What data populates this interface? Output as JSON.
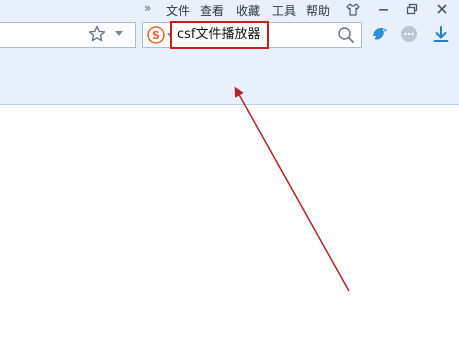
{
  "menubar": {
    "more_glyph": "»",
    "items": [
      "文件",
      "查看",
      "收藏",
      "工具",
      "帮助"
    ]
  },
  "window_controls": {
    "skin": "skin-icon",
    "minimize": "minimize-icon",
    "restore": "restore-icon",
    "close": "close-icon"
  },
  "addressbar": {
    "icons": [
      "star-icon",
      "chevron-down-icon"
    ]
  },
  "search": {
    "engine_icon": "sogou-icon",
    "value": "csf文件播放器",
    "highlight_color": "#c81e1e"
  },
  "toolbar": {
    "icons": [
      "bird-icon",
      "more-icon",
      "download-icon"
    ]
  },
  "annotation": {
    "arrow_color": "#b22222"
  },
  "colors": {
    "chrome_bg": "#e8f1fb",
    "accent_blue": "#2a8fd6"
  }
}
